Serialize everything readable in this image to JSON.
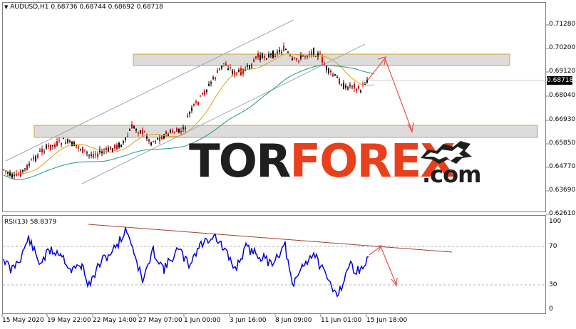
{
  "header": {
    "symbol": "AUDUSD,H1",
    "ohlc": "0.68736 0.68744 0.68692 0.68718",
    "dropdown_icon": "triangle-down-icon"
  },
  "price_axis": {
    "labels": [
      "0.71280",
      "0.70200",
      "0.69120",
      "0.68040",
      "0.66930",
      "0.65850",
      "0.64770",
      "0.63690",
      "0.62610"
    ],
    "current_price": "0.68718"
  },
  "rsi": {
    "label": "RSI(13) 58.8379",
    "levels": [
      "100",
      "70",
      "30",
      "0"
    ]
  },
  "time_axis": {
    "labels": [
      "15 May 2020",
      "19 May 22:00",
      "22 May 14:00",
      "27 May 07:00",
      "1 Jun 00:00",
      "3 Jun 16:00",
      "8 Jun 09:00",
      "11 Jun 01:00",
      "15 Jun 18:00"
    ]
  },
  "logo": {
    "part1": "TOR",
    "part2": "FOREX",
    "suffix": ".com",
    "icon": "bull-bear-icon"
  },
  "colors": {
    "bull_candle": "#000000",
    "bear_candle": "#cc0000",
    "ma_fast": "#e0a020",
    "ma_slow": "#1a9a8a",
    "channel": "#9aaab8",
    "zone_fill": "#dcdcdc",
    "zone_border": "#e0a020",
    "forecast_arrow": "#e85050",
    "rsi_line": "#0000dd",
    "rsi_trend": "#a04030"
  }
}
